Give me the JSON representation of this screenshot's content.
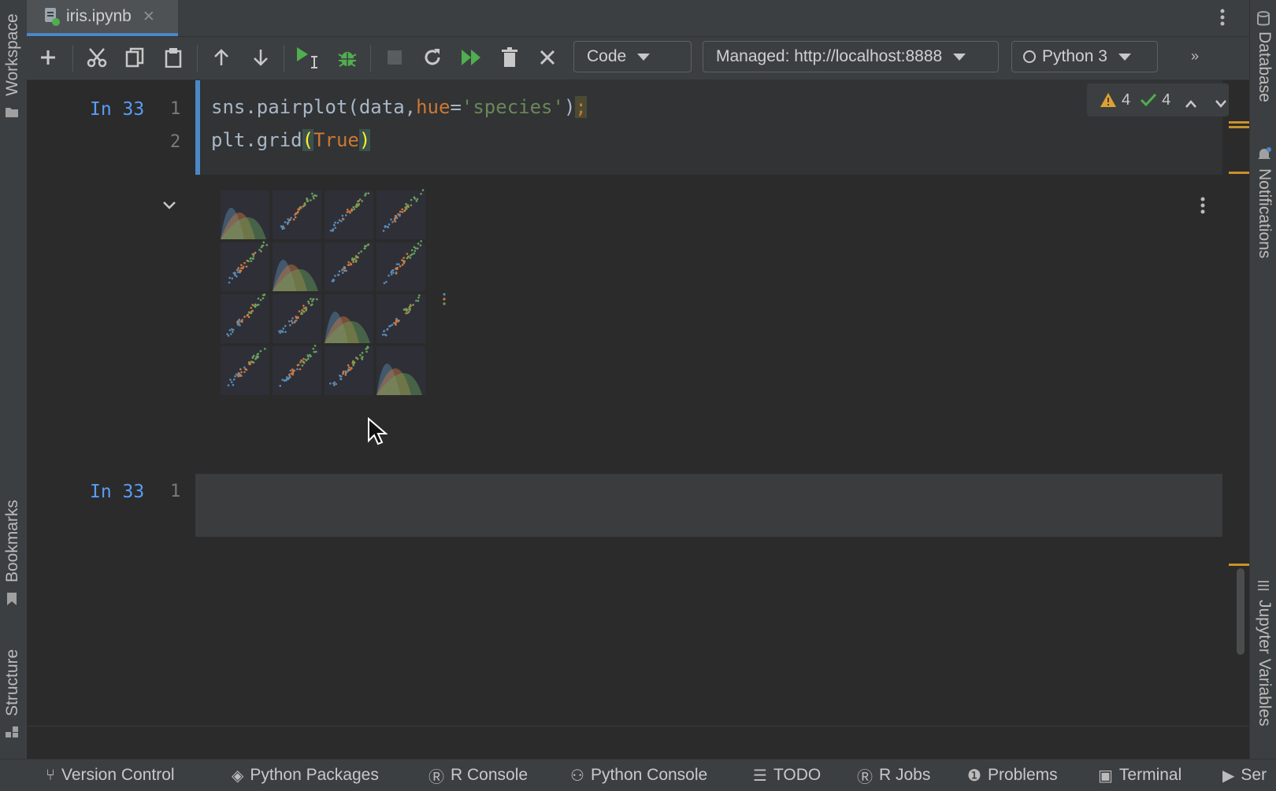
{
  "tab": {
    "label": "iris.ipynb",
    "close": "✕"
  },
  "left_tools": [
    "Workspace",
    "Bookmarks",
    "Structure"
  ],
  "right_tools": [
    "Database",
    "Notifications",
    "Jupyter Variables"
  ],
  "toolbar": {
    "cell_type": "Code",
    "server": "Managed: http://localhost:8888",
    "kernel": "Python 3"
  },
  "inspections": {
    "warnings": "4",
    "ok": "4"
  },
  "cells": [
    {
      "prompt": "In 33",
      "lines": [
        "1",
        "2"
      ]
    },
    {
      "prompt": "In 33",
      "lines": [
        "1"
      ]
    }
  ],
  "code": {
    "l1_a": "sns.pairplot(data,",
    "l1_kw": "hue",
    "l1_eq": "=",
    "l1_str": "'species'",
    "l1_close": ")",
    "l1_semi": ";",
    "l2_a": "plt.grid",
    "l2_open": "(",
    "l2_true": "True",
    "l2_close": ")"
  },
  "statusbar": {
    "items": [
      "Version Control",
      "Python Packages",
      "R Console",
      "Python Console",
      "TODO",
      "R Jobs",
      "Problems",
      "Terminal",
      "Ser"
    ]
  },
  "colors": {
    "accent": "#4a88c7",
    "run_green": "#4fae4f",
    "warning": "#e0a030",
    "setosa": "#5b8bb0",
    "versicolor": "#cf7b3f",
    "virginica": "#67a35a"
  }
}
